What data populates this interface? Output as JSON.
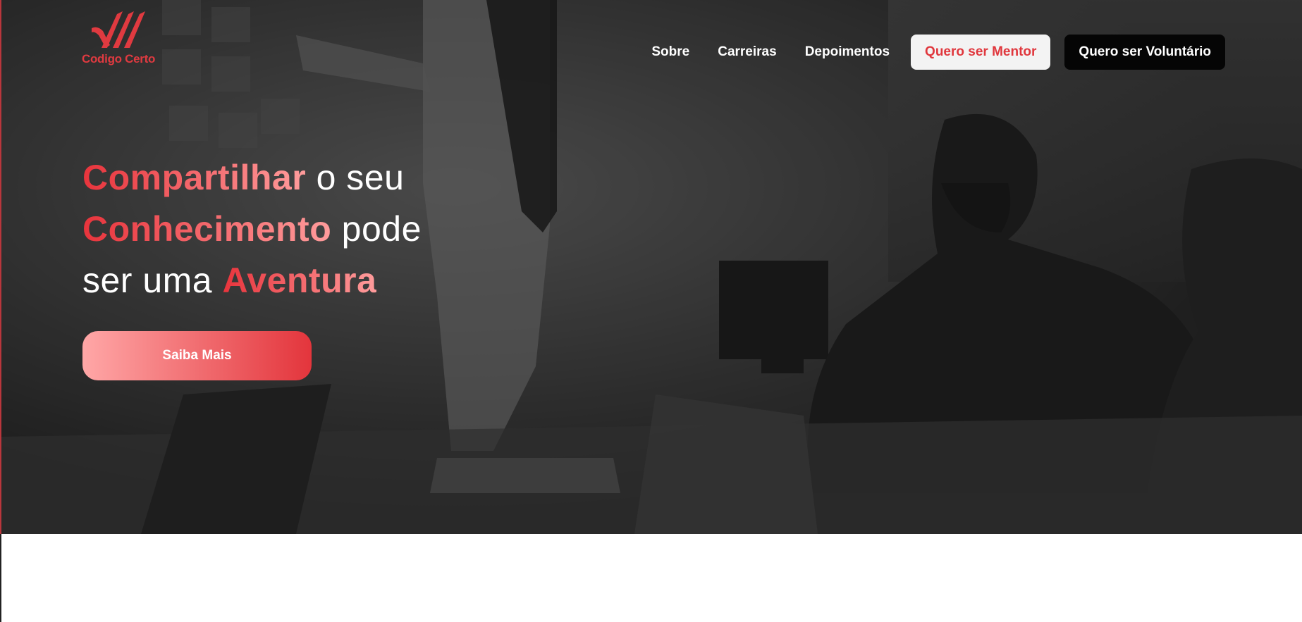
{
  "brand": {
    "name": "Codigo Certo",
    "accent_color": "#e03a40",
    "logo_icon": "diagonal-stripes-logo-icon"
  },
  "nav": {
    "links": [
      "Sobre",
      "Carreiras",
      "Depoimentos"
    ],
    "mentor_button": "Quero ser Mentor",
    "volunteer_button": "Quero ser Voluntário"
  },
  "hero": {
    "headline": {
      "line1_highlight": "Compartilhar",
      "line1_rest": " o seu",
      "line2_highlight": "Conhecimento",
      "line2_rest": " pode",
      "line3_start": "ser uma ",
      "line3_highlight": "Aventura"
    },
    "cta_label": "Saiba Mais",
    "background": "grayscale-office-meeting-photo",
    "gradient_colors": [
      "#e8343c",
      "#ff9c9c"
    ]
  }
}
